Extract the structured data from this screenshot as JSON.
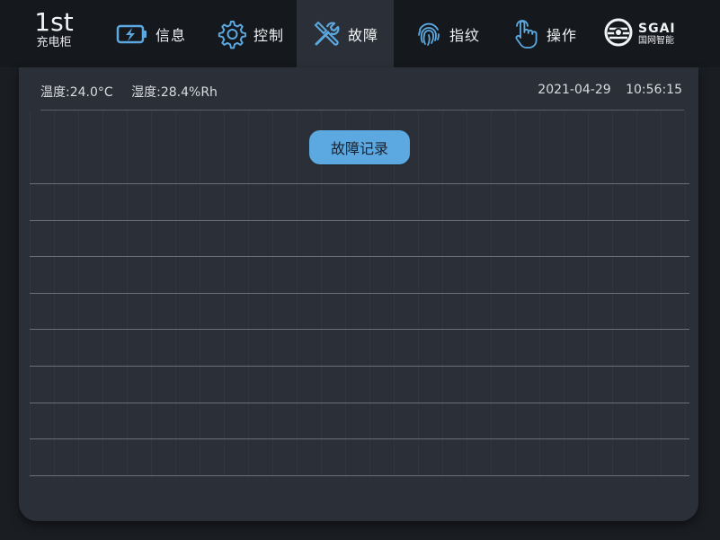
{
  "brand": {
    "big": "1st",
    "small": "充电柜"
  },
  "nav": [
    {
      "label": "信息",
      "icon": "battery-charging-icon",
      "active": false
    },
    {
      "label": "控制",
      "icon": "gear-icon",
      "active": false
    },
    {
      "label": "故障",
      "icon": "tools-icon",
      "active": true
    },
    {
      "label": "指纹",
      "icon": "fingerprint-icon",
      "active": false
    },
    {
      "label": "操作",
      "icon": "hand-pointer-icon",
      "active": false
    }
  ],
  "logo": {
    "name": "SGAI",
    "subtitle": "国网智能"
  },
  "status": {
    "temperature": "温度:24.0°C",
    "humidity": "湿度:28.4%Rh",
    "date": "2021-04-29",
    "time": "10:56:15"
  },
  "main": {
    "record_button": "故障记录",
    "records": [
      "",
      "",
      "",
      "",
      "",
      "",
      "",
      ""
    ]
  },
  "colors": {
    "accent": "#5ba9e0",
    "background": "#1a1d22",
    "panel": "#2b2f37"
  }
}
